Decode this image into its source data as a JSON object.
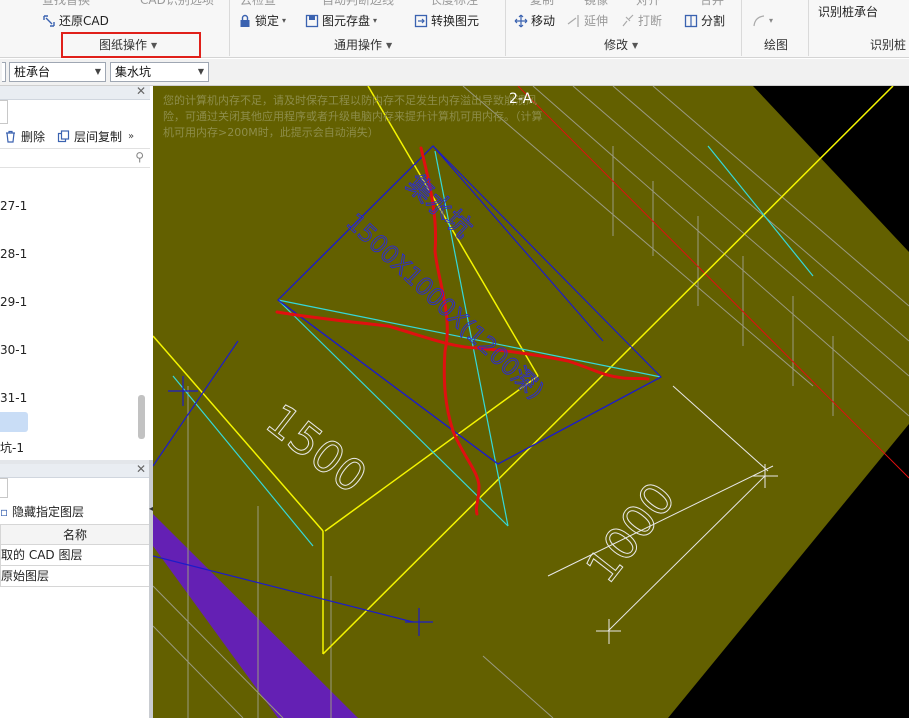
{
  "ribbon": {
    "top_row_partial": [
      "还原CAD"
    ],
    "items": {
      "restore_cad": "还原CAD",
      "lock": "锁定",
      "block_save": "图元存盘",
      "convert_element": "转换图元",
      "move": "移动",
      "extend": "延伸",
      "break": "打断",
      "split": "分割",
      "identify_pile_cap": "识别桩承台",
      "top_partial_1": "查找替换",
      "top_partial_2": "CAD识别选项",
      "top_partial_3": "云检查",
      "top_partial_4": "自动判断边线",
      "top_partial_5": "长度标注",
      "top_partial_6": "复制",
      "top_partial_7": "镜像",
      "top_partial_8": "对齐",
      "top_partial_9": "合并"
    },
    "groups": {
      "drawing_ops": "图纸操作",
      "general_ops": "通用操作",
      "modify": "修改",
      "draw": "绘图",
      "identify": "识别桩"
    }
  },
  "toolbar2": {
    "combo1": "桩承台",
    "combo2": "集水坑"
  },
  "left_panel": {
    "delete_label": "删除",
    "floor_copy_label": "层间复制",
    "tree_items": [
      "27-1",
      "28-1",
      "29-1",
      "30-1",
      "31-1",
      "坑-1"
    ],
    "layers": {
      "hide_specified": "隐藏指定图层",
      "col_name": "名称",
      "rows": [
        "取的 CAD 图层",
        "原始图层"
      ]
    }
  },
  "canvas": {
    "memory_warning": "您的计算机内存不足，请及时保存工程以防内存不足发生内存溢出导致崩溃风险，可通过关闭其他应用程序或者升级电脑内存来提升计算机可用内存。（计算机可用内存>200M时，此提示会自动消失）",
    "axis_label": "2-A",
    "dim_1500": "1500",
    "dim_1000": "1000",
    "pit_name": "集水坑",
    "pit_dims": "1500X1000X(1200深)"
  },
  "colors": {
    "drawing_fill": "#636000",
    "yellow_line": "#f5f500",
    "cyan_line": "#36d8d8",
    "blue_line": "#1c1cc8",
    "red_mark": "#e01010",
    "purple_band": "#6420b4",
    "white_dim": "#e8e8e8",
    "highlight_box": "#e0201a"
  }
}
